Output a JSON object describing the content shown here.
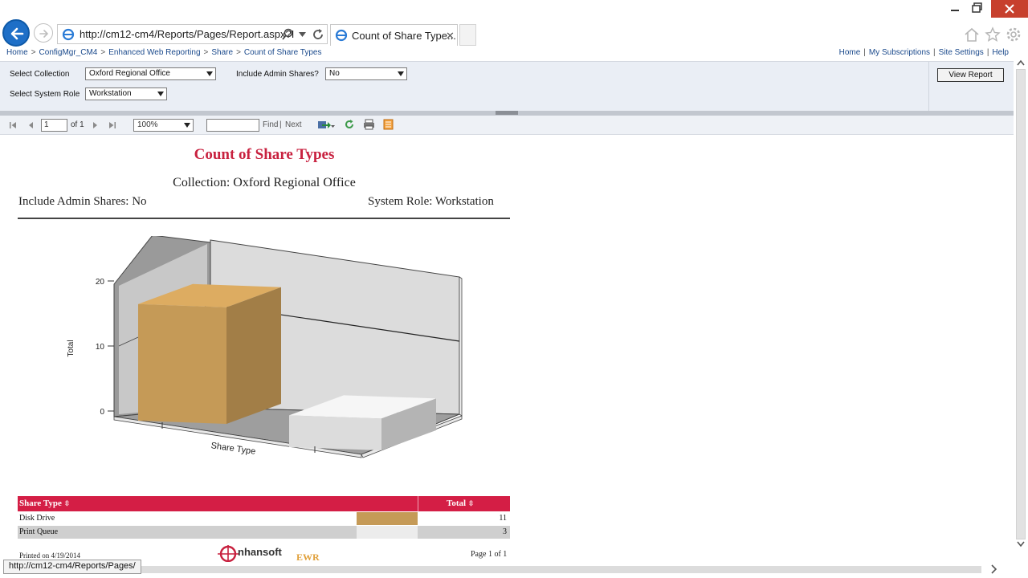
{
  "browser": {
    "url": "http://cm12-cm4/Reports/Pages/Report.aspx?I",
    "tab_title": "Count of Share Type...",
    "tab_close": "✕",
    "status_url": "http://cm12-cm4/Reports/Pages/"
  },
  "breadcrumb": [
    "Home",
    "ConfigMgr_CM4",
    "Enhanced Web Reporting",
    "Share",
    "Count of Share Types"
  ],
  "breadcrumb_sep": ">",
  "top_links": [
    "Home",
    "My Subscriptions",
    "Site Settings",
    "Help"
  ],
  "top_links_sep": "|",
  "params": {
    "collection_label": "Select Collection",
    "collection_value": "Oxford Regional Office",
    "admin_label": "Include Admin Shares?",
    "admin_value": "No",
    "role_label": "Select System Role",
    "role_value": "Workstation",
    "view_report_label": "View Report"
  },
  "toolbar": {
    "page_value": "1",
    "page_of": "of 1",
    "zoom_value": "100%",
    "find_label": "Find",
    "find_sep": "|",
    "next_label": "Next"
  },
  "report": {
    "title": "Count of Share Types",
    "collection_line": "Collection: Oxford Regional Office",
    "admin_line": "Include Admin Shares: No",
    "role_line": "System Role: Workstation",
    "table_headers": [
      "Share Type",
      "Total"
    ],
    "sort_glyph": "⇳",
    "rows": [
      {
        "type": "Disk Drive",
        "total": "11",
        "color": "#c59a57"
      },
      {
        "type": "Print Queue",
        "total": "3",
        "color": "#dcdcdc"
      }
    ],
    "printed_on": "Printed on 4/19/2014",
    "logo_text": "nhansoft",
    "ewr_text": "EWR",
    "page_text": "Page 1 of 1"
  },
  "chart_data": {
    "type": "bar",
    "categories": [
      "Disk Drive",
      "Print Queue"
    ],
    "values": [
      11,
      3
    ],
    "xlabel": "Share Type",
    "ylabel": "Total",
    "ylim": [
      0,
      20
    ],
    "yticks": [
      0,
      10,
      20
    ],
    "colors": [
      "#c59a57",
      "#dcdcdc"
    ]
  }
}
